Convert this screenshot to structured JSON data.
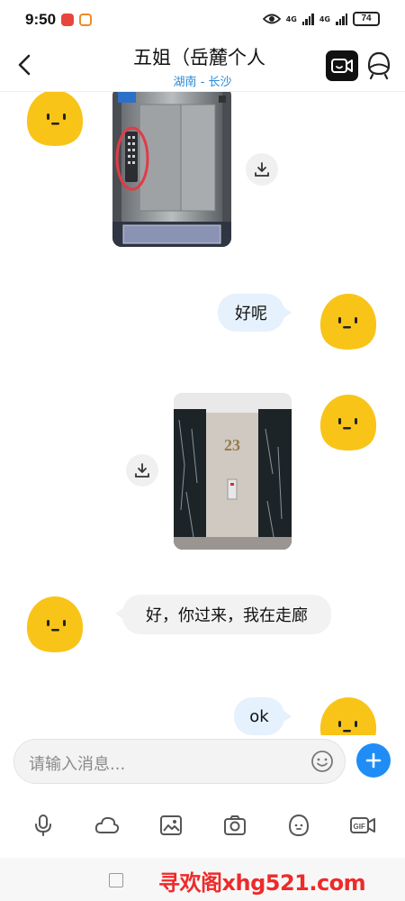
{
  "status_bar": {
    "time": "9:50",
    "network_1": "4G",
    "network_2": "4G",
    "battery": "74"
  },
  "header": {
    "title": "五姐（岳麓个人",
    "subtitle": "湖南 - 长沙",
    "icons": [
      "back-icon",
      "video-call-icon",
      "profile-icon"
    ]
  },
  "messages": [
    {
      "type": "image",
      "direction": "received",
      "depicts": "elevator interior with circled button panel"
    },
    {
      "type": "text",
      "direction": "sent",
      "text": "好呢"
    },
    {
      "type": "image",
      "direction": "sent",
      "depicts": "corridor with floor number 23"
    },
    {
      "type": "text",
      "direction": "received",
      "text": "好，你过来，我在走廊"
    },
    {
      "type": "text",
      "direction": "sent",
      "text": "ok"
    }
  ],
  "input": {
    "placeholder": "请输入消息..."
  },
  "toolbar": {
    "icons": [
      "microphone-icon",
      "cloud-icon",
      "image-icon",
      "camera-icon",
      "emoji-icon",
      "gif-icon"
    ]
  },
  "watermark": "寻欢阁xhg521.com",
  "colors": {
    "accent": "#1f8df5",
    "subtitle": "#2a8ad6",
    "sent_bubble": "#e5f1fc",
    "received_bubble": "#f2f2f2",
    "avatar": "#f9c418",
    "watermark": "#ee2a2a"
  }
}
